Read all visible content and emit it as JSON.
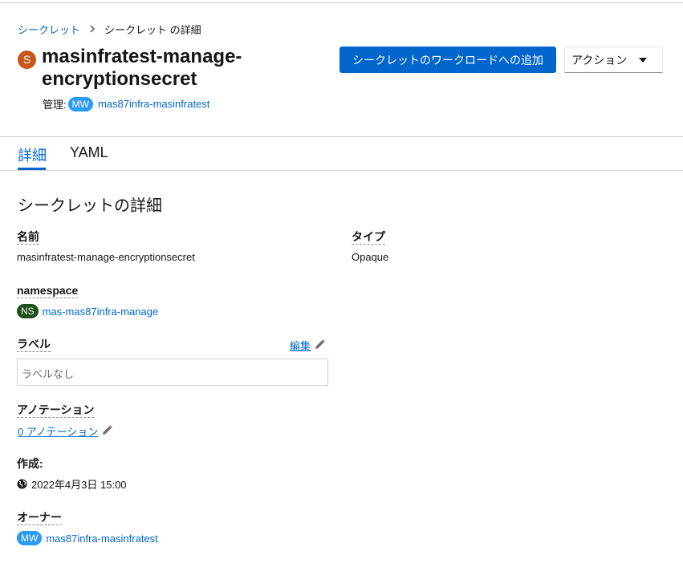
{
  "breadcrumb": {
    "parent": "シークレット",
    "current": "シークレット の詳細"
  },
  "resource": {
    "kind_badge": "S",
    "name_line1": "masinfratest-manage-",
    "name_line2": "encryptionsecret",
    "managed_label": "管理:",
    "managed_badge": "MW",
    "managed_by": "mas87infra-masinfratest"
  },
  "header_actions": {
    "add_to_workload": "シークレットのワークロードへの追加",
    "actions": "アクション"
  },
  "tabs": [
    {
      "label": "詳細",
      "active": true
    },
    {
      "label": "YAML",
      "active": false
    }
  ],
  "details": {
    "section_title": "シークレットの詳細",
    "name_label": "名前",
    "name_value": "masinfratest-manage-encryptionsecret",
    "type_label": "タイプ",
    "type_value": "Opaque",
    "namespace_label": "namespace",
    "namespace_badge": "NS",
    "namespace_value": "mas-mas87infra-manage",
    "labels_label": "ラベル",
    "labels_edit": "編集",
    "labels_empty": "ラベルなし",
    "annotations_label": "アノテーション",
    "annotations_link": "0 アノテーション",
    "created_label": "作成:",
    "created_value": "2022年4月3日 15:00",
    "owner_label": "オーナー",
    "owner_badge": "MW",
    "owner_value": "mas87infra-masinfratest"
  },
  "icons": {
    "breadcrumb_separator": "chevron-right-icon",
    "actions_toggle": "caret-down-icon",
    "edit": "pencil-icon",
    "created": "globe-icon"
  },
  "colors": {
    "link": "#0066cc",
    "primary": "#0066cc",
    "secret_badge": "#c9561a",
    "mw_badge": "#2b9af3",
    "ns_badge": "#1e4f18"
  }
}
